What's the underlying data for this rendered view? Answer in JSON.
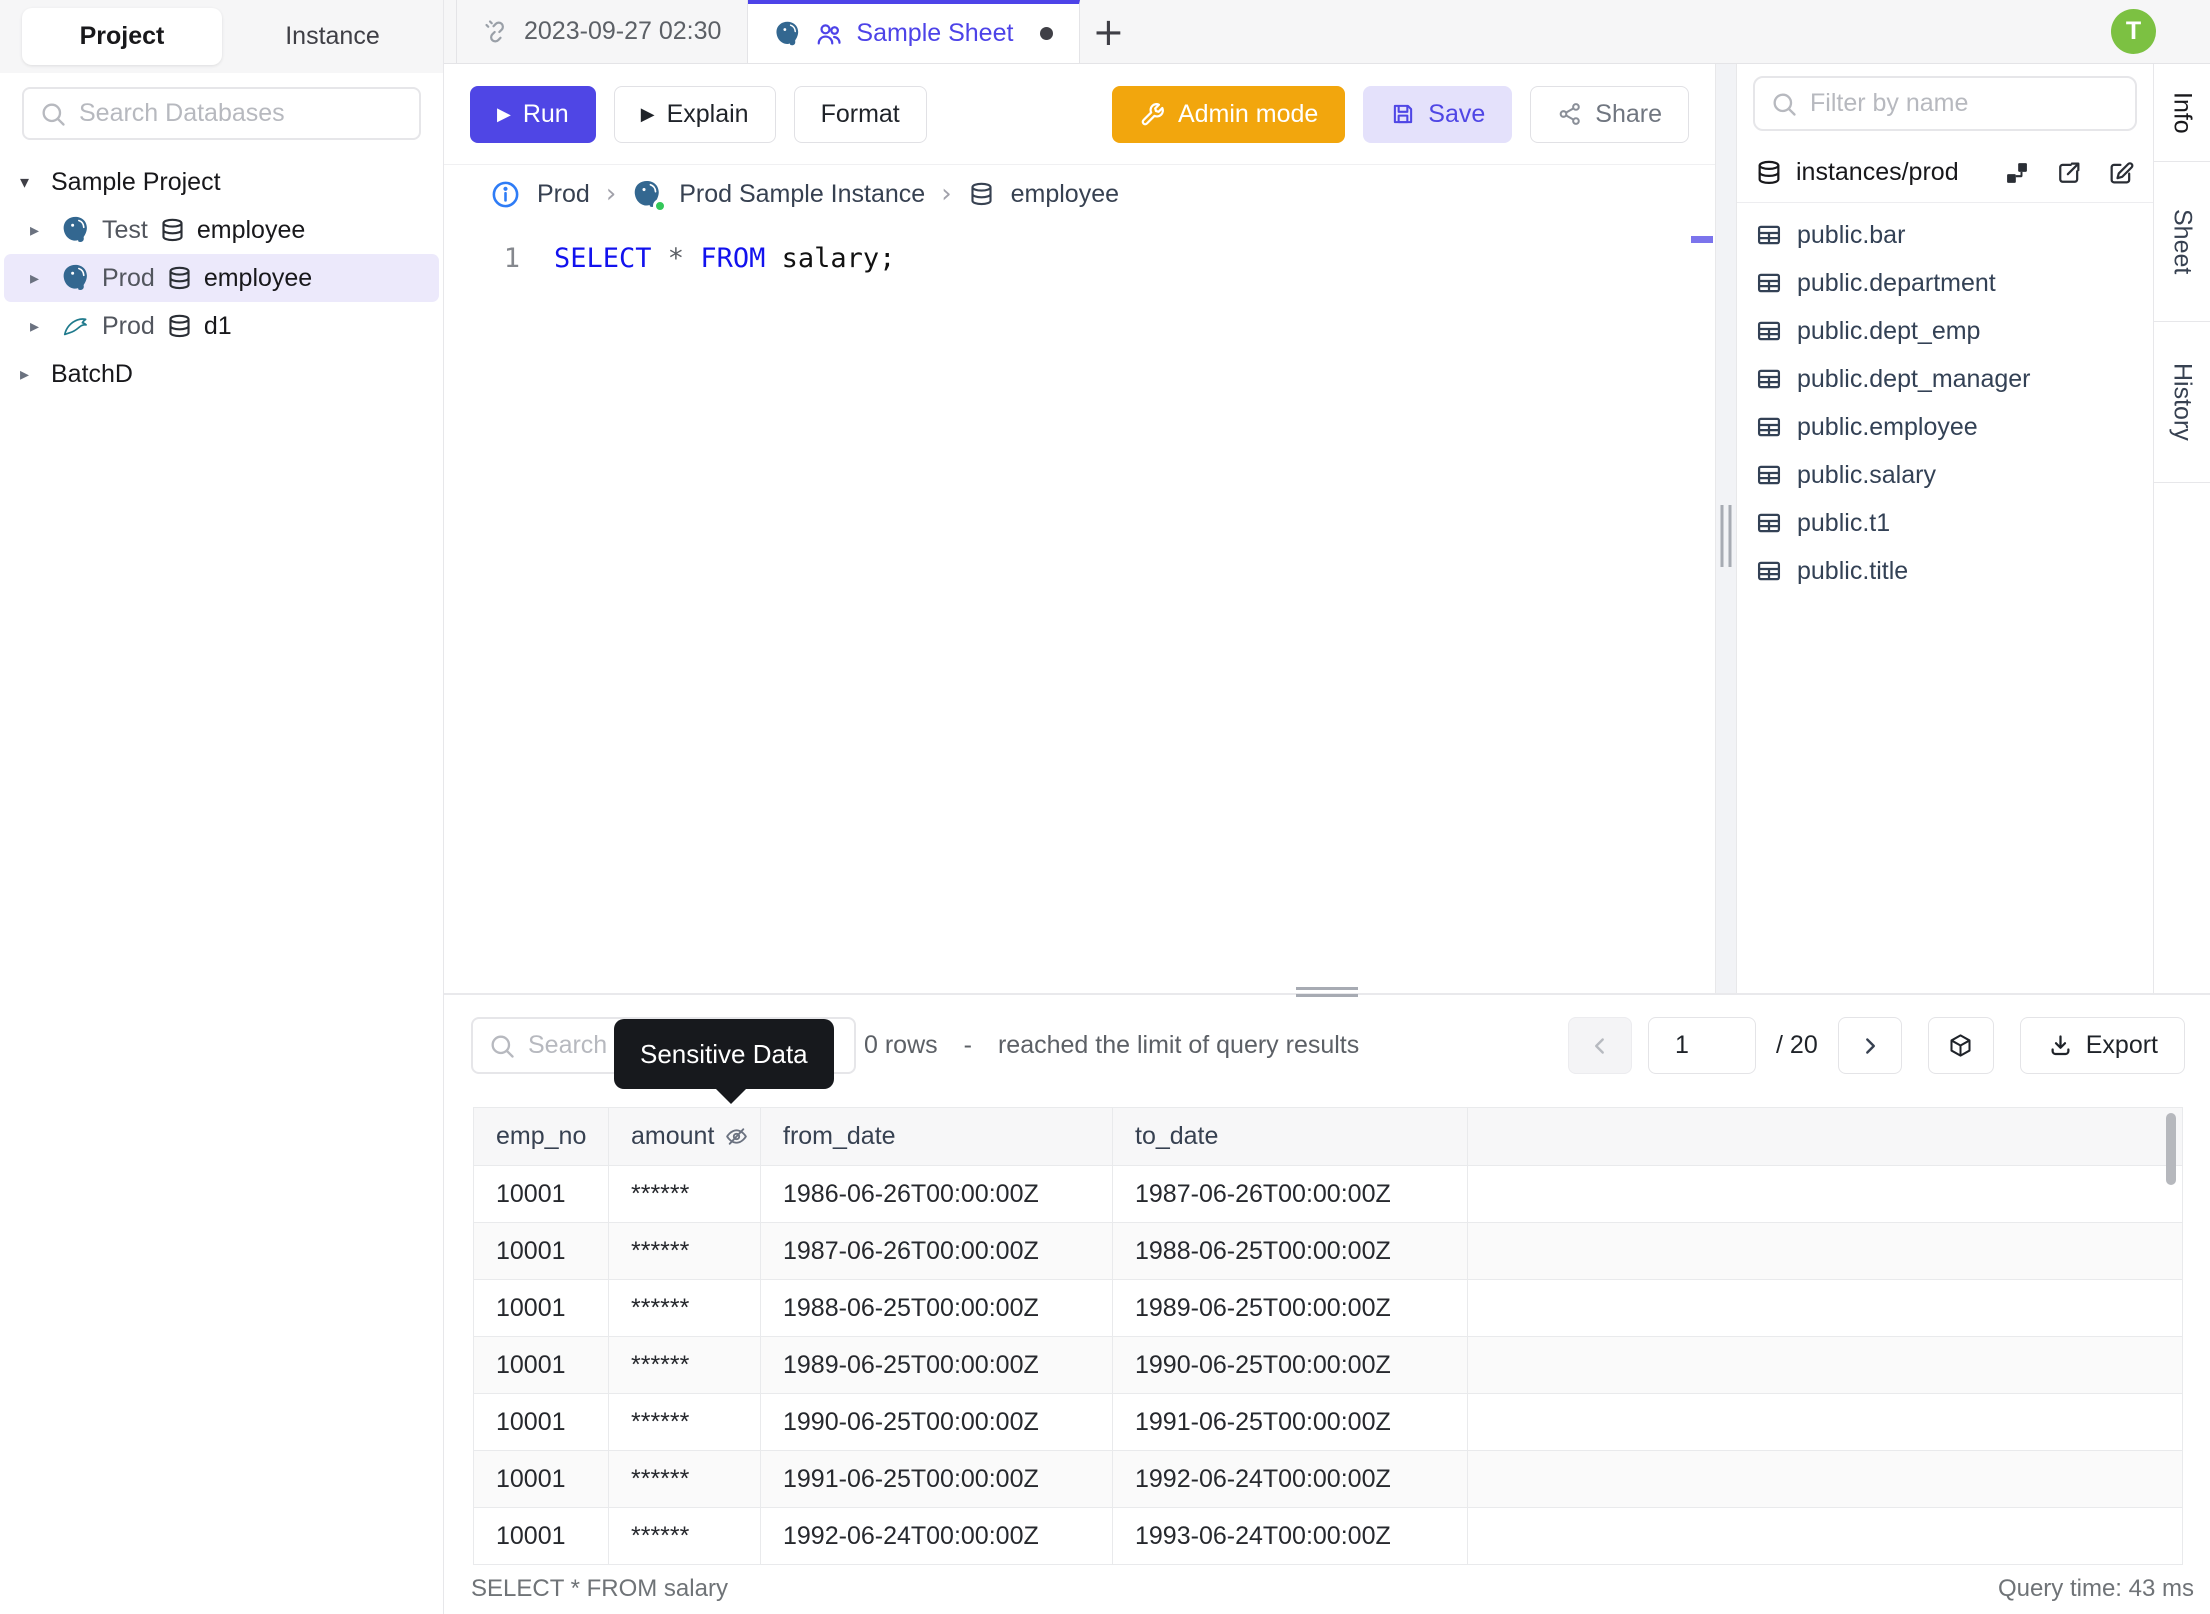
{
  "colors": {
    "accent": "#4F46E5",
    "admin_orange": "#F2A60D",
    "avatar_green": "#7CC142",
    "status_green": "#34C759",
    "keyword_blue": "#1212EE",
    "selected_row": "#ECE9FB",
    "tooltip_bg": "#17191D"
  },
  "glyphs": {
    "caret_down": "▾",
    "caret_right": "▸",
    "play": "▶",
    "plus": "+"
  },
  "sidebar": {
    "tabs": {
      "project": "Project",
      "instance": "Instance"
    },
    "search_placeholder": "Search Databases",
    "tree": {
      "project": "Sample Project",
      "items": [
        {
          "engine": "postgres",
          "env": "Test",
          "db": "employee"
        },
        {
          "engine": "postgres",
          "env": "Prod",
          "db": "employee"
        },
        {
          "engine": "mysql",
          "env": "Prod",
          "db": "d1"
        }
      ],
      "batch": "BatchD"
    }
  },
  "tabbar": {
    "tab1_label": "2023-09-27 02:30",
    "tab2_label": "Sample Sheet",
    "avatar_initial": "T"
  },
  "toolbar": {
    "run": "Run",
    "explain": "Explain",
    "format": "Format",
    "admin": "Admin mode",
    "save": "Save",
    "share": "Share"
  },
  "breadcrumb": {
    "env": "Prod",
    "separator": "›",
    "instance": "Prod Sample Instance",
    "database": "employee"
  },
  "editor": {
    "line_no": "1",
    "tokens": {
      "kw1": "SELECT ",
      "star": "* ",
      "kw2": "FROM ",
      "tail": "salary;"
    }
  },
  "schema": {
    "filter_placeholder": "Filter by name",
    "scope": "instances/prod",
    "tables": [
      "public.bar",
      "public.department",
      "public.dept_emp",
      "public.dept_manager",
      "public.employee",
      "public.salary",
      "public.t1",
      "public.title"
    ]
  },
  "side_tabs": {
    "info": "Info",
    "sheet": "Sheet",
    "history": "History"
  },
  "results": {
    "search_placeholder": "Search",
    "tooltip": "Sensitive Data",
    "rows_count": "0 rows",
    "dash": "-",
    "limit_note": "reached the limit of query results",
    "pagination": {
      "page": "1",
      "total": "/ 20"
    },
    "export_label": "Export",
    "columns": {
      "c0": "emp_no",
      "c1": "amount",
      "c2": "from_date",
      "c3": "to_date"
    },
    "rows": [
      [
        "10001",
        "******",
        "1986-06-26T00:00:00Z",
        "1987-06-26T00:00:00Z"
      ],
      [
        "10001",
        "******",
        "1987-06-26T00:00:00Z",
        "1988-06-25T00:00:00Z"
      ],
      [
        "10001",
        "******",
        "1988-06-25T00:00:00Z",
        "1989-06-25T00:00:00Z"
      ],
      [
        "10001",
        "******",
        "1989-06-25T00:00:00Z",
        "1990-06-25T00:00:00Z"
      ],
      [
        "10001",
        "******",
        "1990-06-25T00:00:00Z",
        "1991-06-25T00:00:00Z"
      ],
      [
        "10001",
        "******",
        "1991-06-25T00:00:00Z",
        "1992-06-24T00:00:00Z"
      ],
      [
        "10001",
        "******",
        "1992-06-24T00:00:00Z",
        "1993-06-24T00:00:00Z"
      ]
    ]
  },
  "status": {
    "query": "SELECT * FROM salary",
    "time": "Query time: 43 ms"
  }
}
